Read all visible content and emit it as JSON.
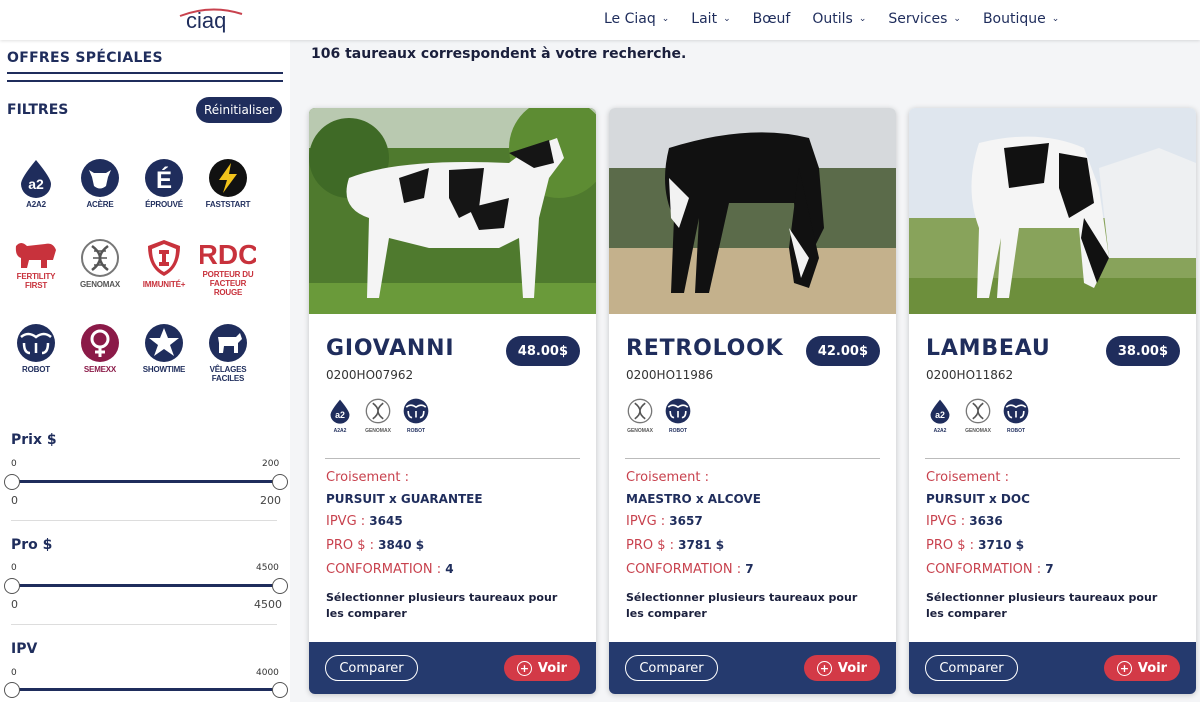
{
  "brand": {
    "logo_text": "ciaq",
    "navy": "#1f2d5c",
    "red": "#d33a47"
  },
  "nav": [
    {
      "label": "Le Ciaq",
      "chevron": true
    },
    {
      "label": "Lait",
      "chevron": true
    },
    {
      "label": "Bœuf",
      "chevron": false
    },
    {
      "label": "Outils",
      "chevron": true
    },
    {
      "label": "Services",
      "chevron": true
    },
    {
      "label": "Boutique",
      "chevron": true
    }
  ],
  "sidebar": {
    "offres": "OFFRES SPÉCIALES",
    "filtres": "FILTRES",
    "reset": "Réinitialiser",
    "filters": [
      {
        "label": "A2A2",
        "icon": "a2-drop-icon"
      },
      {
        "label": "ACÈRE",
        "icon": "cow-head-icon"
      },
      {
        "label": "ÉPROUVÉ",
        "icon": "e-accent-icon"
      },
      {
        "label": "FASTSTART",
        "icon": "lightning-icon"
      },
      {
        "label": "FERTILITY FIRST",
        "icon": "bull-icon"
      },
      {
        "label": "GENOMAX",
        "icon": "dna-icon"
      },
      {
        "label": "IMMUNITÉ+",
        "icon": "shield-icon"
      },
      {
        "label": "PORTEUR DU FACTEUR ROUGE",
        "icon": "rdc-icon",
        "big": "RDC"
      },
      {
        "label": "ROBOT",
        "icon": "robot-icon"
      },
      {
        "label": "SEMEXX",
        "icon": "female-symbol-icon"
      },
      {
        "label": "SHOWTIME",
        "icon": "star-icon"
      },
      {
        "label": "VÊLAGES FACILES",
        "icon": "calf-icon"
      }
    ],
    "sliders": [
      {
        "title": "Prix $",
        "tick_min": "0",
        "tick_max": "200",
        "min": "0",
        "max": "200"
      },
      {
        "title": "Pro $",
        "tick_min": "0",
        "tick_max": "4500",
        "min": "0",
        "max": "4500"
      },
      {
        "title": "IPV",
        "tick_min": "0",
        "tick_max": "4000",
        "min": "0",
        "max": "4000"
      }
    ]
  },
  "results_text": "106 taureaux correspondent à votre recherche.",
  "labels": {
    "croisement": "Croisement :",
    "ipvg": "IPVG : ",
    "pro": "PRO $ : ",
    "conf": "CONFORMATION : ",
    "select": "Sélectionner plusieurs taureaux pour les comparer",
    "compare": "Comparer",
    "voir": "Voir"
  },
  "cards": [
    {
      "name": "GIOVANNI",
      "price": "48.00$",
      "code": "0200HO07962",
      "badges": [
        "A2A2",
        "GENOMAX",
        "ROBOT"
      ],
      "cross": "PURSUIT x GUARANTEE",
      "ipvg": "3645",
      "pro": "3840 $",
      "conf": "4"
    },
    {
      "name": "RETROLOOK",
      "price": "42.00$",
      "code": "0200HO11986",
      "badges": [
        "GENOMAX",
        "ROBOT"
      ],
      "cross": "MAESTRO x ALCOVE",
      "ipvg": "3657",
      "pro": "3781 $",
      "conf": "7"
    },
    {
      "name": "LAMBEAU",
      "price": "38.00$",
      "code": "0200HO11862",
      "badges": [
        "A2A2",
        "GENOMAX",
        "ROBOT"
      ],
      "cross": "PURSUIT x DOC",
      "ipvg": "3636",
      "pro": "3710 $",
      "conf": "7"
    }
  ]
}
